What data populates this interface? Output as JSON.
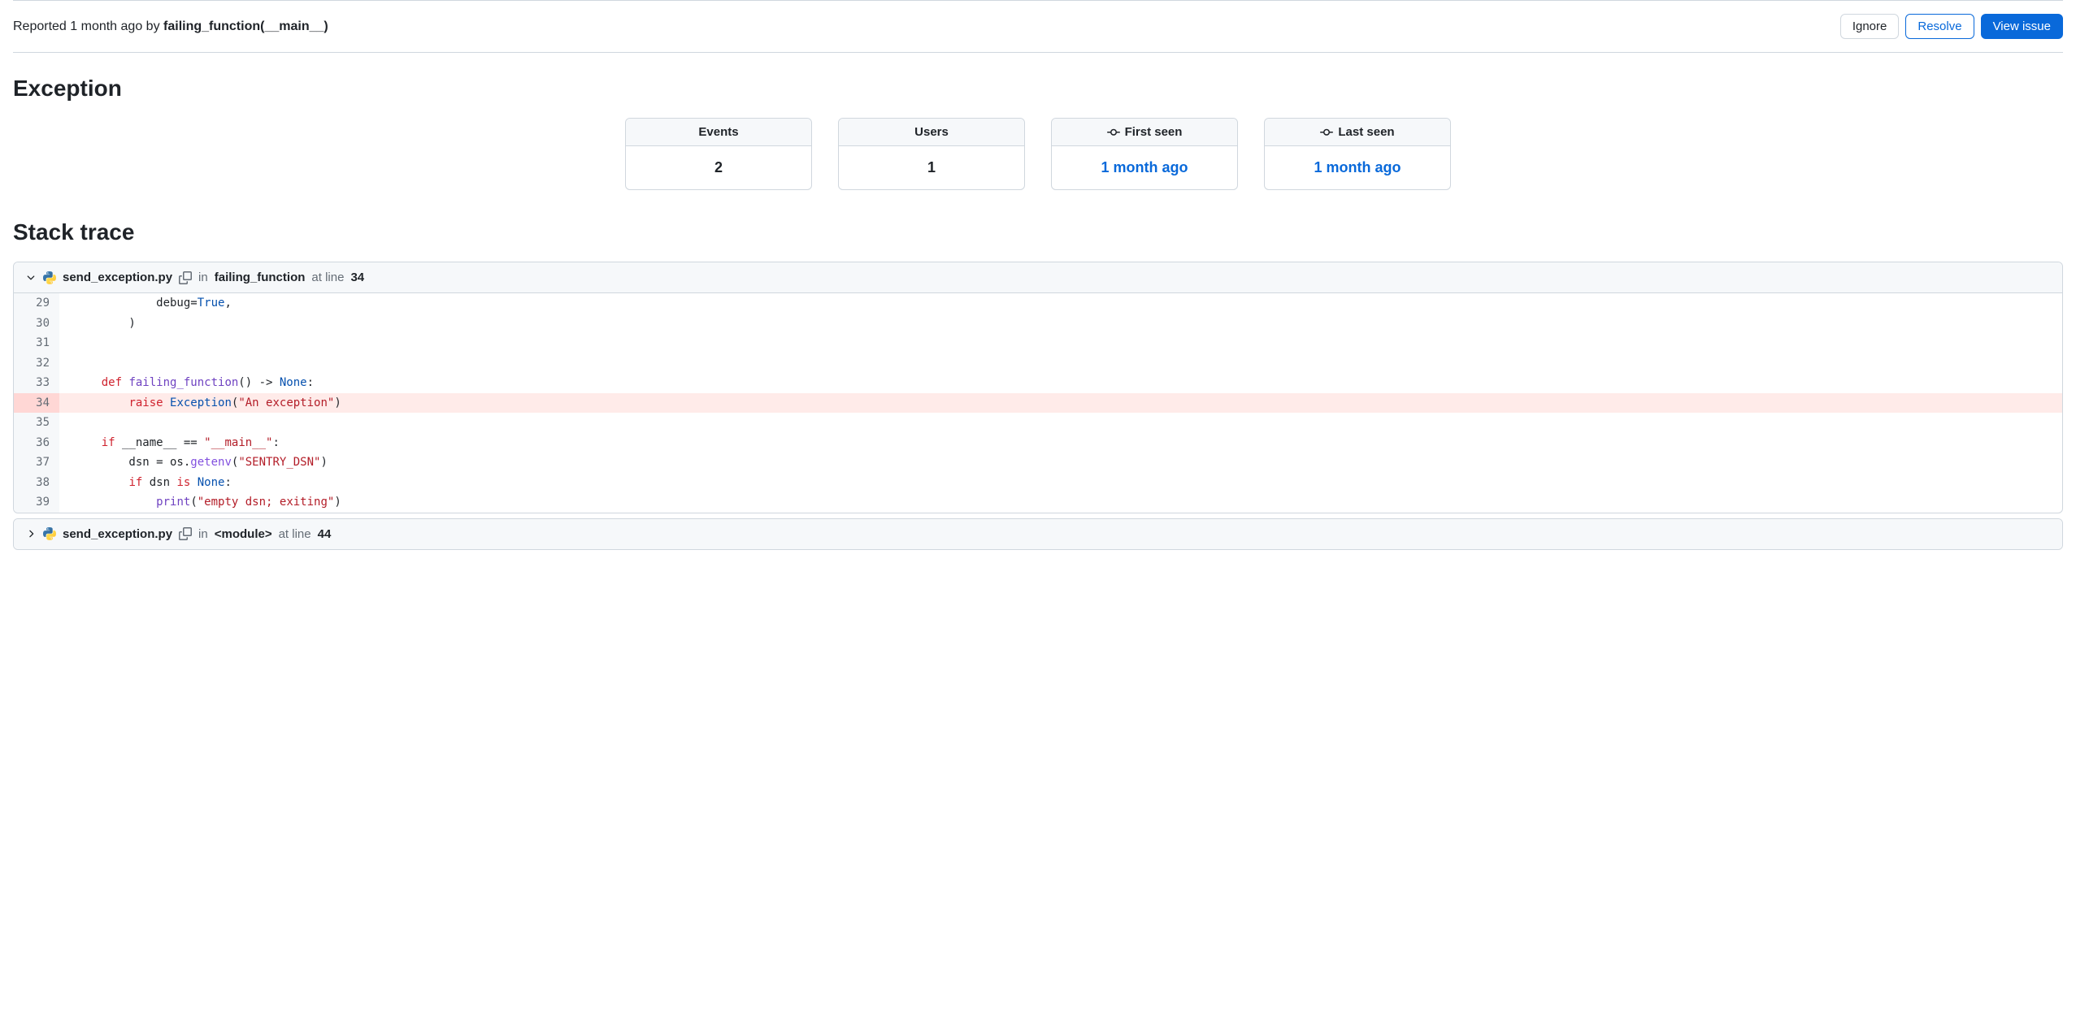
{
  "header": {
    "reported_prefix": "Reported 1 month ago by ",
    "reported_by": "failing_function(__main__)",
    "buttons": {
      "ignore": "Ignore",
      "resolve": "Resolve",
      "view_issue": "View issue"
    }
  },
  "exception": {
    "title": "Exception",
    "stats": [
      {
        "label": "Events",
        "value": "2",
        "icon": false,
        "link": false
      },
      {
        "label": "Users",
        "value": "1",
        "icon": false,
        "link": false
      },
      {
        "label": "First seen",
        "value": "1 month ago",
        "icon": true,
        "link": true
      },
      {
        "label": "Last seen",
        "value": "1 month ago",
        "icon": true,
        "link": true
      }
    ]
  },
  "stacktrace": {
    "title": "Stack trace",
    "frames": [
      {
        "expanded": true,
        "filename": "send_exception.py",
        "in_text": "in",
        "function": "failing_function",
        "at_line_text": "at line",
        "line": "34",
        "code": [
          {
            "num": "29",
            "hl": false,
            "indent": "            ",
            "tokens": [
              [
                "",
                "debug="
              ],
              [
                "const",
                "True"
              ],
              [
                "",
                ","
              ]
            ]
          },
          {
            "num": "30",
            "hl": false,
            "indent": "        ",
            "tokens": [
              [
                "",
                ")"
              ]
            ]
          },
          {
            "num": "31",
            "hl": false,
            "indent": "",
            "tokens": []
          },
          {
            "num": "32",
            "hl": false,
            "indent": "",
            "tokens": []
          },
          {
            "num": "33",
            "hl": false,
            "indent": "    ",
            "tokens": [
              [
                "kw",
                "def "
              ],
              [
                "def-name",
                "failing_function"
              ],
              [
                "",
                "() -> "
              ],
              [
                "const",
                "None"
              ],
              [
                "",
                ":"
              ]
            ]
          },
          {
            "num": "34",
            "hl": true,
            "indent": "        ",
            "tokens": [
              [
                "kw",
                "raise "
              ],
              [
                "cls",
                "Exception"
              ],
              [
                "",
                "("
              ],
              [
                "str",
                "\"An exception\""
              ],
              [
                "",
                ")"
              ]
            ]
          },
          {
            "num": "35",
            "hl": false,
            "indent": "",
            "tokens": []
          },
          {
            "num": "36",
            "hl": false,
            "indent": "    ",
            "tokens": [
              [
                "kw",
                "if "
              ],
              [
                "",
                "__name__ == "
              ],
              [
                "str",
                "\"__main__\""
              ],
              [
                "",
                ":"
              ]
            ]
          },
          {
            "num": "37",
            "hl": false,
            "indent": "        ",
            "tokens": [
              [
                "",
                "dsn = os."
              ],
              [
                "fn",
                "getenv"
              ],
              [
                "",
                "("
              ],
              [
                "str",
                "\"SENTRY_DSN\""
              ],
              [
                "",
                ")"
              ]
            ]
          },
          {
            "num": "38",
            "hl": false,
            "indent": "        ",
            "tokens": [
              [
                "kw",
                "if "
              ],
              [
                "",
                "dsn "
              ],
              [
                "kw",
                "is "
              ],
              [
                "const",
                "None"
              ],
              [
                "",
                ":"
              ]
            ]
          },
          {
            "num": "39",
            "hl": false,
            "indent": "            ",
            "tokens": [
              [
                "builtin",
                "print"
              ],
              [
                "",
                "("
              ],
              [
                "str",
                "\"empty dsn; exiting\""
              ],
              [
                "",
                ")"
              ]
            ]
          }
        ]
      },
      {
        "expanded": false,
        "filename": "send_exception.py",
        "in_text": "in",
        "function": "<module>",
        "at_line_text": "at line",
        "line": "44"
      }
    ]
  }
}
